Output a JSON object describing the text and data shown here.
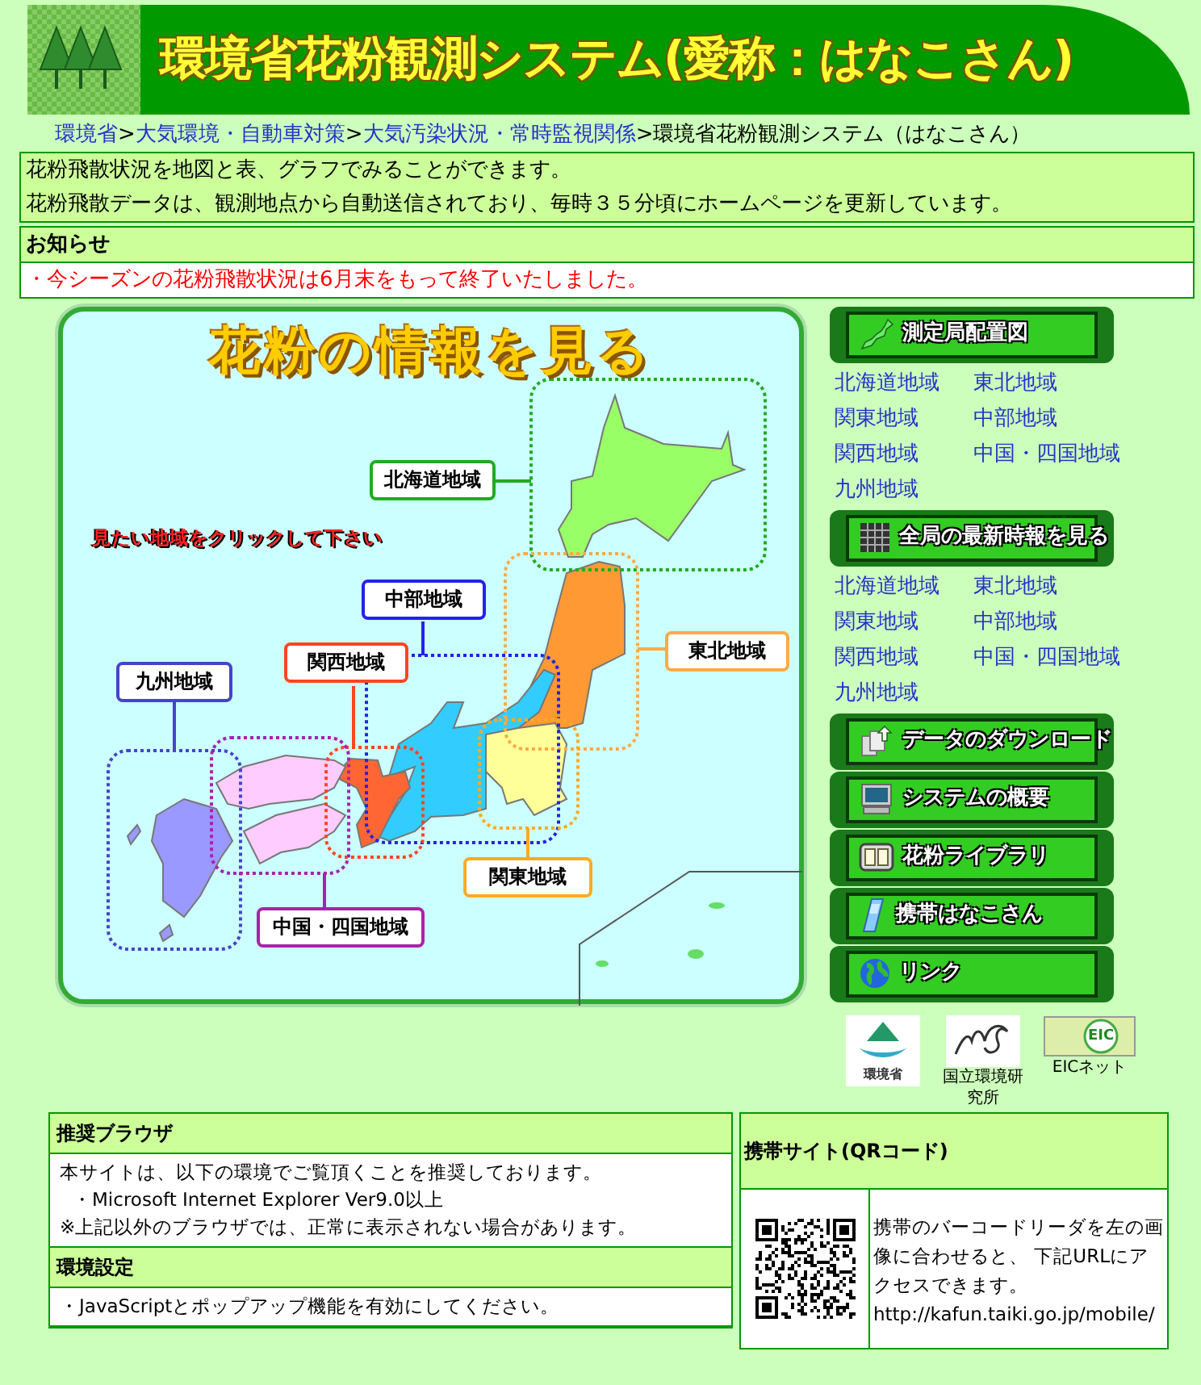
{
  "header": {
    "title": "環境省花粉観測システム(愛称：はなこさん)"
  },
  "breadcrumb": [
    {
      "label": "環境省",
      "link": true,
      "sep": ">"
    },
    {
      "label": "大気環境・自動車対策",
      "link": true,
      "sep": ">"
    },
    {
      "label": "大気汚染状況・常時監視関係",
      "link": true,
      "sep": ">"
    },
    {
      "label": "環境省花粉観測システム（はなこさん）",
      "link": false
    }
  ],
  "intro": [
    "花粉飛散状況を地図と表、グラフでみることができます。",
    "花粉飛散データは、観測地点から自動送信されており、毎時３５分頃にホームページを更新しています。"
  ],
  "notice": {
    "heading": "お知らせ",
    "items": [
      "・今シーズンの花粉飛散状況は6月末をもって終了いたしました。"
    ]
  },
  "map": {
    "title": "花粉の情報を見る",
    "prompt": "見たい地域をクリックして下さい",
    "regions": [
      {
        "label": "北海道地域",
        "color": "#99ff66",
        "frame": {
          "color": "#22aa22"
        }
      },
      {
        "label": "東北地域",
        "color": "#ff9933",
        "frame": {
          "color": "#ffaa44"
        }
      },
      {
        "label": "中部地域",
        "color": "#33ccff",
        "frame": {
          "color": "#2222ee"
        }
      },
      {
        "label": "関西地域",
        "color": "#ff6633",
        "frame": {
          "color": "#ff4422"
        }
      },
      {
        "label": "九州地域",
        "color": "#9999ff",
        "frame": {
          "color": "#4444cc"
        }
      },
      {
        "label": "関東地域",
        "color": "#ffff99",
        "frame": {
          "color": "#ffaa22"
        }
      },
      {
        "label": "中国・四国地域",
        "color": "#ffccff",
        "frame": {
          "color": "#aa22aa"
        }
      }
    ]
  },
  "sidebar": [
    {
      "label": "測定局配置図",
      "links": [
        "北海道地域",
        "東北地域",
        "関東地域",
        "中部地域",
        "関西地域",
        "中国・四国地域",
        "九州地域"
      ]
    },
    {
      "label": "全局の最新時報を見る",
      "links": [
        "北海道地域",
        "東北地域",
        "関東地域",
        "中部地域",
        "関西地域",
        "中国・四国地域",
        "九州地域"
      ]
    },
    {
      "label": "データのダウンロード"
    },
    {
      "label": "システムの概要"
    },
    {
      "label": "花粉ライブラリ"
    },
    {
      "label": "携帯はなこさん"
    },
    {
      "label": "リンク"
    }
  ],
  "partners": [
    {
      "logo_text": "環境省"
    },
    {
      "caption": "国立環境研究所"
    },
    {
      "logo_text": "EIC",
      "caption": "EICネット"
    }
  ],
  "browser_panel": [
    {
      "heading": "推奨ブラウザ",
      "lines": [
        "本サイトは、以下の環境でご覧頂くことを推奨しております。",
        "・Microsoft Internet Explorer Ver9.0以上",
        "※上記以外のブラウザでは、正常に表示されない場合があります。"
      ]
    },
    {
      "heading": "環境設定",
      "lines": [
        "・JavaScriptとポップアップ機能を有効にしてください。"
      ]
    }
  ],
  "mobile": {
    "heading": "携帯サイト(QRコード)",
    "text": "携帯のバーコードリーダを左の画像に合わせると、 下記URLにアクセスできます。",
    "url": "http://kafun.taiki.go.jp/mobile/"
  }
}
